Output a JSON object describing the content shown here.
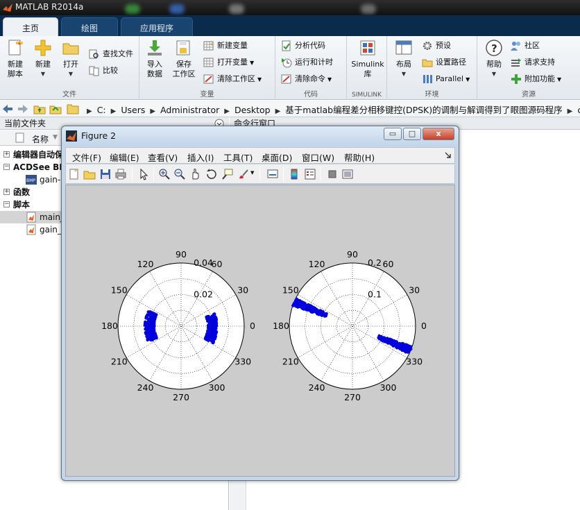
{
  "app": {
    "title": "MATLAB R2014a"
  },
  "tabs": [
    {
      "label": "主页",
      "active": true
    },
    {
      "label": "绘图",
      "active": false
    },
    {
      "label": "应用程序",
      "active": false
    }
  ],
  "ribbon": {
    "file_group": {
      "label": "文件",
      "new_script": "新建\n脚本",
      "new": "新建",
      "open": "打开",
      "find_files": "查找文件",
      "compare": "比较"
    },
    "variable_group": {
      "label": "变量",
      "import_data": "导入\n数据",
      "save_workspace": "保存\n工作区",
      "new_variable": "新建变量",
      "open_variable": "打开变量",
      "clear_workspace": "清除工作区"
    },
    "code_group": {
      "label": "代码",
      "analyze_code": "分析代码",
      "run_and_time": "运行和计时",
      "clear_commands": "清除命令"
    },
    "simulink_group": {
      "label": "SIMULINK",
      "simulink_library": "Simulink\n库"
    },
    "environment_group": {
      "label": "环境",
      "layout": "布局",
      "preferences": "预设",
      "set_path": "设置路径",
      "parallel": "Parallel"
    },
    "resources_group": {
      "label": "资源",
      "help": "帮助",
      "community": "社区",
      "request_support": "请求支持",
      "add_ons": "附加功能"
    }
  },
  "address_bar": {
    "path": [
      "C:",
      "Users",
      "Administrator",
      "Desktop",
      "基于matlab编程差分相移键控(DPSK)的调制与解调得到了眼图源码程序",
      "code"
    ]
  },
  "current_folder": {
    "title": "当前文件夹",
    "column_name": "名称",
    "items": [
      {
        "label": "编辑器自动保",
        "type": "group",
        "expanded": false
      },
      {
        "label": "ACDSee BM",
        "type": "group",
        "expanded": true
      },
      {
        "label": "gain-",
        "type": "bmp-file"
      },
      {
        "label": "函数",
        "type": "group",
        "expanded": false
      },
      {
        "label": "脚本",
        "type": "group",
        "expanded": true
      },
      {
        "label": "main_",
        "type": "m-file",
        "selected": true
      },
      {
        "label": "gain_",
        "type": "m-file"
      }
    ]
  },
  "command_window": {
    "title": "命令行窗口"
  },
  "figure": {
    "title": "Figure 2",
    "window_buttons": {
      "minimize": "▭",
      "maximize": "□",
      "close": "x"
    },
    "menu": [
      "文件(F)",
      "编辑(E)",
      "查看(V)",
      "插入(I)",
      "工具(T)",
      "桌面(D)",
      "窗口(W)",
      "帮助(H)"
    ],
    "toolbar_icons": [
      "new-figure-icon",
      "open-file-icon",
      "save-icon",
      "print-icon",
      "pointer-icon",
      "zoom-in-icon",
      "zoom-out-icon",
      "pan-icon",
      "rotate-3d-icon",
      "data-cursor-icon",
      "brush-icon",
      "link-plot-icon",
      "colorbar-icon",
      "legend-icon",
      "hide-plot-tools-icon",
      "show-plot-tools-icon"
    ]
  },
  "chart_data": [
    {
      "type": "scatter",
      "coordinate_system": "polar",
      "rlim": [
        0,
        0.04
      ],
      "r_tick_labels": [
        "0.02",
        "0.04"
      ],
      "theta_tick_labels": [
        "0",
        "30",
        "60",
        "90",
        "120",
        "150",
        "180",
        "210",
        "240",
        "270",
        "300",
        "330"
      ],
      "grid": true,
      "marker_color": "#0000dd",
      "clusters": [
        {
          "theta_range": [
            20,
            -28
          ],
          "r_range": [
            0.017,
            0.023
          ],
          "count": 260
        },
        {
          "theta_range": [
            155,
            206
          ],
          "r_range": [
            0.017,
            0.023
          ],
          "count": 260
        }
      ]
    },
    {
      "type": "scatter",
      "coordinate_system": "polar",
      "rlim": [
        0,
        0.2
      ],
      "r_tick_labels": [
        "0.1",
        "0.2"
      ],
      "theta_tick_labels": [
        "0",
        "30",
        "60",
        "90",
        "120",
        "150",
        "180",
        "210",
        "240",
        "270",
        "300",
        "330"
      ],
      "grid": true,
      "marker_color": "#0000dd",
      "clusters": [
        {
          "theta_range": [
            154,
            161
          ],
          "r_range": [
            0.09,
            0.2
          ],
          "count": 200
        },
        {
          "theta_range": [
            -26,
            -19
          ],
          "r_range": [
            0.09,
            0.2
          ],
          "count": 200
        }
      ]
    }
  ]
}
